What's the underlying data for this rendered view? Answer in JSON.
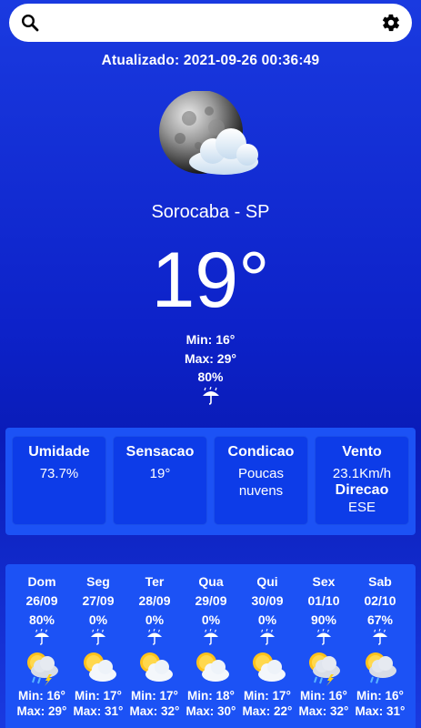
{
  "search": {
    "placeholder": ""
  },
  "updated": "Atualizado: 2021-09-26 00:36:49",
  "location": "Sorocaba - SP",
  "current": {
    "temp": "19°",
    "min": "Min: 16°",
    "max": "Max: 29°",
    "rain_chance": "80%",
    "icon": "moon-cloud-icon"
  },
  "details": {
    "humidity": {
      "title": "Umidade",
      "value": "73.7%"
    },
    "feels": {
      "title": "Sensacao",
      "value": "19°"
    },
    "condition": {
      "title": "Condicao",
      "value_line1": "Poucas",
      "value_line2": "nuvens"
    },
    "wind": {
      "title": "Vento",
      "value": "23.1Km/h",
      "dir_title": "Direcao",
      "dir_value": "ESE"
    }
  },
  "forecast": [
    {
      "day": "Dom",
      "date": "26/09",
      "pct": "80%",
      "icon": "storm-sun-icon",
      "min": "Min: 16°",
      "max": "Max: 29°"
    },
    {
      "day": "Seg",
      "date": "27/09",
      "pct": "0%",
      "icon": "sun-cloud-icon",
      "min": "Min: 17°",
      "max": "Max: 31°"
    },
    {
      "day": "Ter",
      "date": "28/09",
      "pct": "0%",
      "icon": "sun-cloud-icon",
      "min": "Min: 17°",
      "max": "Max: 32°"
    },
    {
      "day": "Qua",
      "date": "29/09",
      "pct": "0%",
      "icon": "sun-cloud-icon",
      "min": "Min: 18°",
      "max": "Max: 30°"
    },
    {
      "day": "Qui",
      "date": "30/09",
      "pct": "0%",
      "icon": "sun-cloud-icon",
      "min": "Min: 17°",
      "max": "Max: 22°"
    },
    {
      "day": "Sex",
      "date": "01/10",
      "pct": "90%",
      "icon": "storm-sun-icon",
      "min": "Min: 16°",
      "max": "Max: 32°"
    },
    {
      "day": "Sab",
      "date": "02/10",
      "pct": "67%",
      "icon": "rain-sun-icon",
      "min": "Min: 16°",
      "max": "Max: 31°"
    }
  ]
}
